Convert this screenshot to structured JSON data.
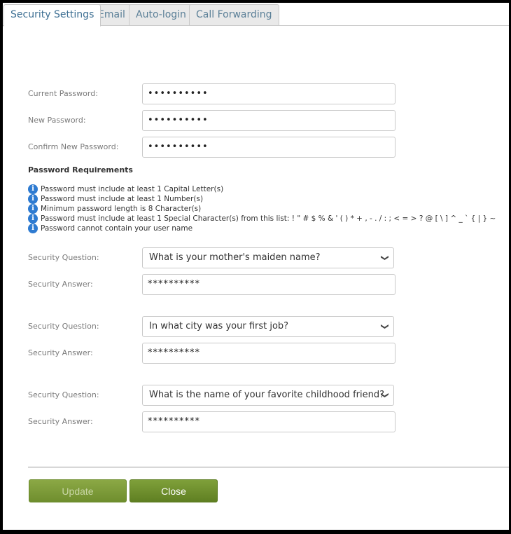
{
  "tabs": [
    {
      "label": "Security Settings",
      "active": true
    },
    {
      "label": "Email",
      "active": false
    },
    {
      "label": "Auto-login",
      "active": false
    },
    {
      "label": "Call Forwarding",
      "active": false
    }
  ],
  "password": {
    "current_label": "Current Password:",
    "current_value": "••••••••••",
    "new_label": "New Password:",
    "new_value": "••••••••••",
    "confirm_label": "Confirm New Password:",
    "confirm_value": "••••••••••"
  },
  "requirements": {
    "title": "Password Requirements",
    "items": [
      "Password must include at least 1 Capital Letter(s)",
      "Password must include at least 1 Number(s)",
      "Minimum password length is 8 Character(s)",
      "Password must include at least 1 Special Character(s) from this list: ! \" # $ % & ' ( ) * + , - . / : ; < = > ? @ [ \\ ] ^ _ ` { | } ~",
      "Password cannot contain your user name"
    ]
  },
  "security": [
    {
      "question_label": "Security Question:",
      "question": "What is your mother's maiden name?",
      "answer_label": "Security Answer:",
      "answer": "**********"
    },
    {
      "question_label": "Security Question:",
      "question": "In what city was your first job?",
      "answer_label": "Security Answer:",
      "answer": "**********"
    },
    {
      "question_label": "Security Question:",
      "question": "What is the name of your favorite childhood friend?",
      "answer_label": "Security Answer:",
      "answer": "**********"
    }
  ],
  "buttons": {
    "update": "Update",
    "close": "Close"
  },
  "icons": {
    "info": "info-icon",
    "dropdown": "chevron-down-icon"
  },
  "colors": {
    "accent_green": "#6f8e2e",
    "tab_text": "#5a7f97",
    "info_blue": "#2e7bd1"
  }
}
